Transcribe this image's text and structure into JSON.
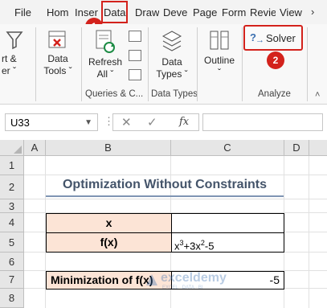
{
  "tabs": [
    "File",
    "Hom",
    "Inser",
    "Data",
    "Draw",
    "Deve",
    "Page",
    "Form",
    "Revie",
    "View"
  ],
  "ribbon": {
    "partial_left": [
      "rt &",
      "er"
    ],
    "data_tools": [
      "Data",
      "Tools"
    ],
    "refresh": [
      "Refresh",
      "All"
    ],
    "data_types": [
      "Data",
      "Types"
    ],
    "outline": "Outline",
    "solver": "Solver",
    "groups": [
      "Queries & C...",
      "Data Types",
      "Analyze"
    ]
  },
  "badges": [
    "1",
    "2"
  ],
  "formula_bar": {
    "name_box": "U33",
    "fx": "fx",
    "content": ""
  },
  "grid": {
    "columns": [
      "A",
      "B",
      "C",
      "D"
    ],
    "rows": [
      "1",
      "2",
      "3",
      "4",
      "5",
      "6",
      "7",
      "8"
    ]
  },
  "sheet": {
    "title": "Optimization Without Constraints",
    "x_label": "x",
    "fx_label": "f(x)",
    "fx_value": {
      "a": "x",
      "b": "3",
      "c": "+3x",
      "d": "2",
      "e": "-5"
    },
    "min_label": "Minimization of f(x)",
    "min_value": "-5"
  },
  "watermark": {
    "name": "exceldemy",
    "tagline": "EXCEL · DATA · BI"
  }
}
